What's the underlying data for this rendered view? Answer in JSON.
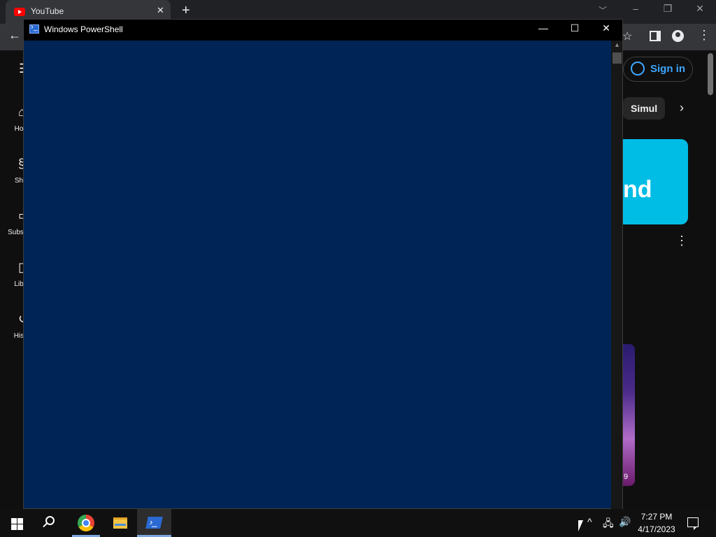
{
  "browser": {
    "tab": {
      "title": "YouTube",
      "close_icon": "close-icon"
    },
    "new_tab_label": "+",
    "tab_search_icon": "chevron-down-icon",
    "window_buttons": {
      "minimize": "–",
      "restore": "❐",
      "close": "✕"
    },
    "toolbar": {
      "back": "←",
      "star": "☆",
      "menu": "⋮"
    }
  },
  "youtube": {
    "menu_icon": "☰",
    "sidebar": [
      {
        "label": "Ho",
        "icon": "home-icon",
        "glyph": "⌂"
      },
      {
        "label": "Sh",
        "icon": "shorts-icon",
        "glyph": "§"
      },
      {
        "label": "Subsc",
        "icon": "subscriptions-icon",
        "glyph": "▭"
      },
      {
        "label": "Lib",
        "icon": "library-icon",
        "glyph": "▯"
      },
      {
        "label": "His",
        "icon": "history-icon",
        "glyph": "↺"
      }
    ],
    "sign_in": "Sign in",
    "chip": "Simul",
    "chip_next": "›",
    "banner_text": "nd",
    "more": "⋮",
    "thumb_text": "9"
  },
  "powershell": {
    "title": "Windows PowerShell",
    "buttons": {
      "minimize": "—",
      "maximize": "☐",
      "close": "✕"
    },
    "scroll_up": "▲",
    "background": "#012456"
  },
  "taskbar": {
    "clock": {
      "time": "7:27 PM",
      "date": "4/17/2023"
    },
    "tray": {
      "chevron": "^",
      "network": "🖧",
      "volume": "🔊"
    },
    "apps": [
      "start",
      "search",
      "chrome",
      "file-explorer",
      "powershell"
    ]
  }
}
